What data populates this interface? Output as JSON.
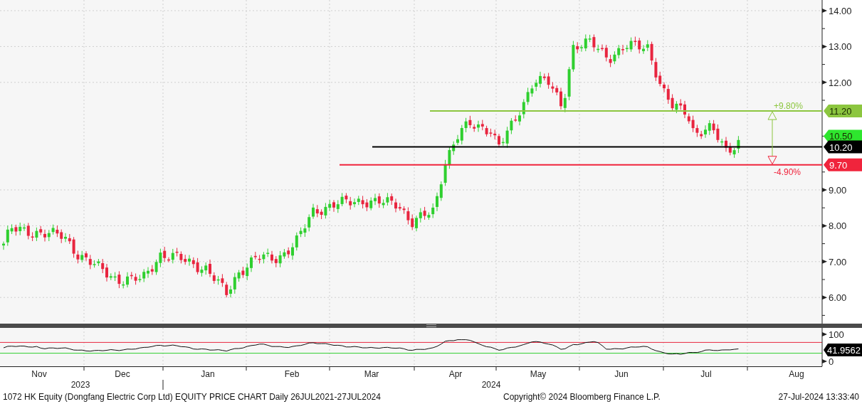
{
  "price_axis": {
    "ticks": [
      "14.00",
      "13.00",
      "12.00",
      "9.00",
      "8.00",
      "7.00",
      "6.00"
    ]
  },
  "levels": [
    {
      "kind": "line",
      "label": "11.20",
      "color": "#8cc63f"
    },
    {
      "kind": "last",
      "label": "10.50",
      "color": "#2ee62e"
    },
    {
      "kind": "line",
      "label": "10.20",
      "color": "#000000"
    },
    {
      "kind": "line",
      "label": "9.70",
      "color": "#f0243c"
    }
  ],
  "range_arrow": {
    "up_label": "+9.80%",
    "down_label": "-4.90%"
  },
  "rsi_panel": {
    "ticks": [
      "100",
      "0"
    ],
    "last": "41.9562"
  },
  "x_axis": {
    "months": [
      "Nov",
      "Dec",
      "Jan",
      "Feb",
      "Mar",
      "Apr",
      "May",
      "Jun",
      "Jul",
      "Aug"
    ],
    "years": [
      "2023",
      "2024"
    ]
  },
  "footer": {
    "title": "1072 HK Equity (Dongfang Electric Corp Ltd) EQUITY PRICE CHART  Daily 26JUL2021-27JUL2024",
    "copyright": "Copyright© 2024 Bloomberg Finance L.P.",
    "timestamp": "27-Jul-2024 13:33:40"
  }
}
